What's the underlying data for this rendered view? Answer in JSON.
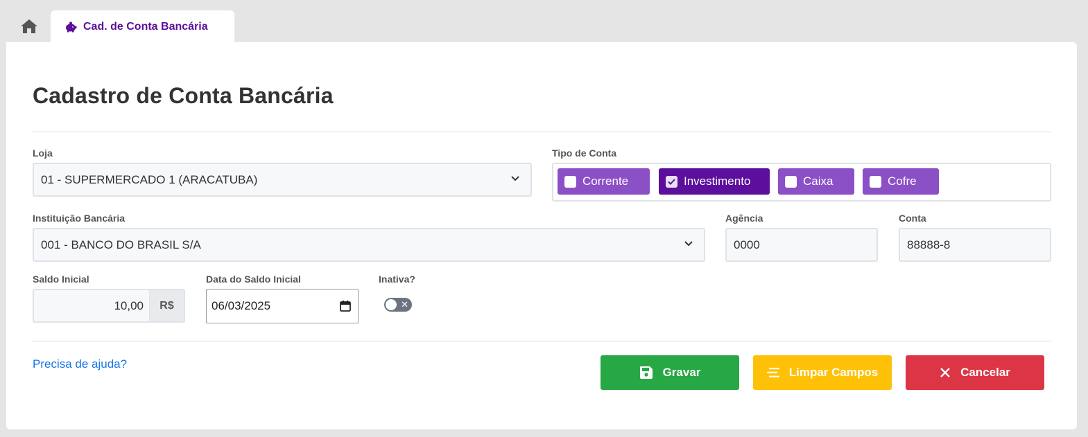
{
  "tabs": {
    "home_icon": "home-icon",
    "active": {
      "icon": "piggy-bank-icon",
      "label": "Cad. de Conta Bancária",
      "color": "#5b0f9c"
    }
  },
  "page": {
    "title": "Cadastro de Conta Bancária"
  },
  "form": {
    "loja": {
      "label": "Loja",
      "value": "01 - SUPERMERCADO 1 (ARACATUBA)"
    },
    "tipo_conta": {
      "label": "Tipo de Conta",
      "options": [
        {
          "label": "Corrente",
          "checked": false
        },
        {
          "label": "Investimento",
          "checked": true
        },
        {
          "label": "Caixa",
          "checked": false
        },
        {
          "label": "Cofre",
          "checked": false
        }
      ]
    },
    "instituicao": {
      "label": "Instituição Bancária",
      "value": "001 - BANCO DO BRASIL S/A"
    },
    "agencia": {
      "label": "Agência",
      "value": "0000"
    },
    "conta": {
      "label": "Conta",
      "value": "88888-8"
    },
    "saldo_inicial": {
      "label": "Saldo Inicial",
      "value": "10,00",
      "currency": "R$"
    },
    "data_saldo": {
      "label": "Data do Saldo Inicial",
      "value": "06/03/2025"
    },
    "inativa": {
      "label": "Inativa?",
      "on": false
    }
  },
  "footer": {
    "help_link": "Precisa de ajuda?",
    "save_label": "Gravar",
    "clear_label": "Limpar Campos",
    "cancel_label": "Cancelar"
  },
  "colors": {
    "purple": "#8b4fc6",
    "purple_active": "#5b0f9c",
    "save": "#28a745",
    "clear": "#ffc107",
    "cancel": "#dc3545",
    "link": "#1a73e8"
  }
}
